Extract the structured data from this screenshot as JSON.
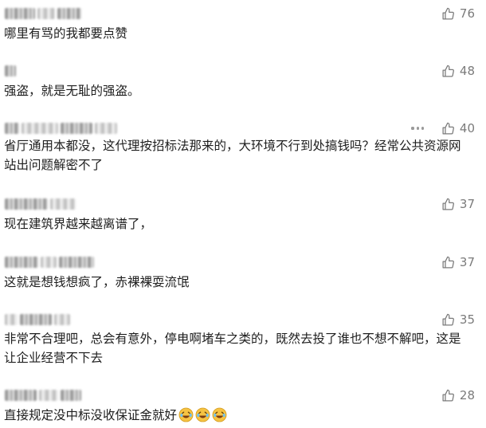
{
  "comments": [
    {
      "text": "哪里有骂的我都要点赞",
      "likes": "76",
      "has_menu": false
    },
    {
      "text": "强盗，就是无耻的强盗。",
      "likes": "48",
      "has_menu": false
    },
    {
      "text": "省厅通用本都没，这代理按招标法那来的，大环境不行到处搞钱吗？经常公共资源网站出问题解密不了",
      "likes": "40",
      "has_menu": true
    },
    {
      "text": "现在建筑界越来越离谱了，",
      "likes": "37",
      "has_menu": false
    },
    {
      "text": "这就是想钱想疯了，赤裸裸耍流氓",
      "likes": "37",
      "has_menu": false
    },
    {
      "text": "非常不合理吧，总会有意外，停电啊堵车之类的，既然去投了谁也不想不解吧，这是让企业经营不下去",
      "likes": "35",
      "has_menu": false
    },
    {
      "text": "直接规定没中标没收保证金就好",
      "likes": "28",
      "has_menu": false,
      "emoji": "laughing-crying-emoji"
    }
  ],
  "icons": {
    "like": "thumbs-up-icon",
    "menu": "more-dots-icon"
  },
  "colors": {
    "text": "#1e1e1e",
    "meta": "#7b7b7b",
    "emoji": "#f6c343"
  }
}
